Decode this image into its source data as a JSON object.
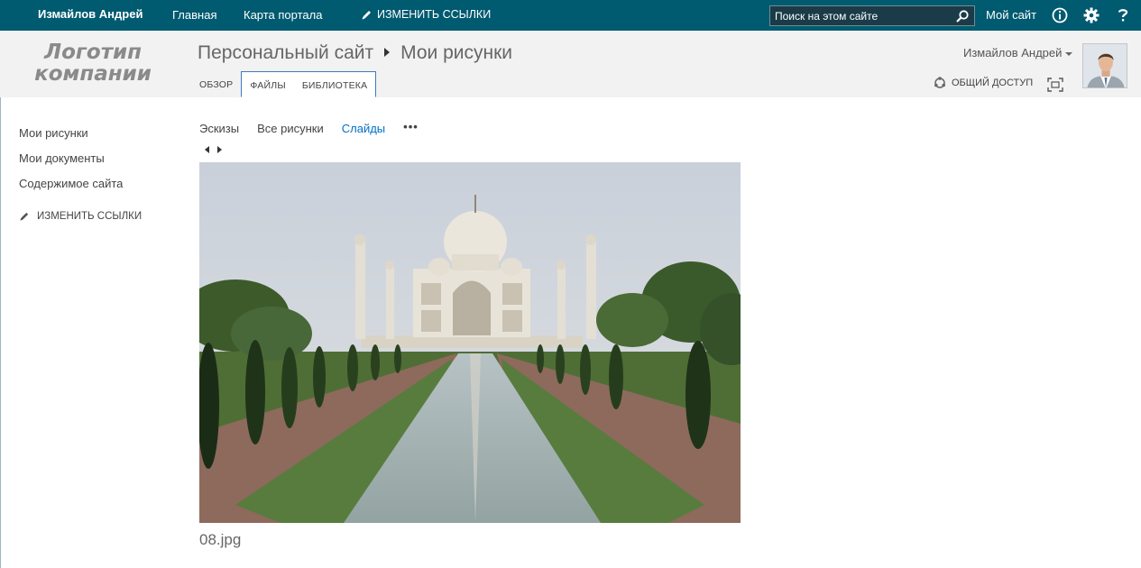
{
  "suite_bar": {
    "user_name": "Измайлов Андрей",
    "nav": [
      "Главная",
      "Карта портала"
    ],
    "edit_links": "ИЗМЕНИТЬ ССЫЛКИ",
    "search_placeholder": "Поиск на этом сайте",
    "my_site": "Мой сайт",
    "icons": [
      "search-icon",
      "info-icon",
      "gear-icon",
      "help-icon"
    ]
  },
  "header": {
    "logo": "Логотип компании",
    "breadcrumb": [
      "Персональный сайт",
      "Мои рисунки"
    ],
    "tabs": [
      {
        "label": "ОБЗОР",
        "active": false
      },
      {
        "label": "ФАЙЛЫ",
        "active": true
      },
      {
        "label": "БИБЛИОТЕКА",
        "active": true
      }
    ],
    "user": "Измайлов Андрей",
    "share": "ОБЩИЙ ДОСТУП"
  },
  "left_nav": {
    "items": [
      "Мои рисунки",
      "Мои документы",
      "Содержимое сайта"
    ],
    "edit_links": "ИЗМЕНИТЬ ССЫЛКИ"
  },
  "views": {
    "items": [
      {
        "label": "Эскизы",
        "active": false
      },
      {
        "label": "Все рисунки",
        "active": false
      },
      {
        "label": "Слайды",
        "active": true
      }
    ],
    "more": "•••"
  },
  "slide": {
    "filename": "08.jpg"
  },
  "colors": {
    "suite_bar": "#005a70",
    "header_bg": "#f2f2f2",
    "active_view": "#0072c6"
  }
}
